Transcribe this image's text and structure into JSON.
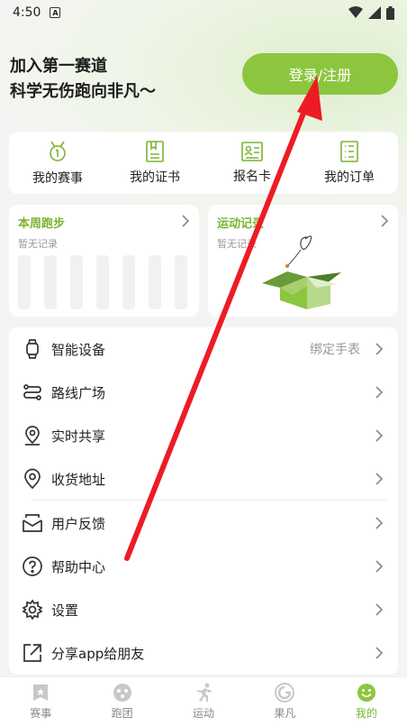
{
  "status_bar": {
    "time": "4:50",
    "notice_glyph": "A"
  },
  "header": {
    "slogan_line1": "加入第一赛道",
    "slogan_line2": "科学无伤跑向非凡～",
    "login_label": "登录/注册"
  },
  "quick_actions": [
    {
      "label": "我的赛事",
      "icon": "medal-icon"
    },
    {
      "label": "我的证书",
      "icon": "certificate-icon"
    },
    {
      "label": "报名卡",
      "icon": "id-card-icon"
    },
    {
      "label": "我的订单",
      "icon": "order-list-icon"
    }
  ],
  "weekly_run": {
    "title": "本周跑步",
    "empty_text": "暂无记录"
  },
  "activity_log": {
    "title": "运动记录",
    "empty_text": "暂无记录"
  },
  "menu": [
    {
      "label": "智能设备",
      "extra": "绑定手表",
      "icon": "watch-icon"
    },
    {
      "label": "路线广场",
      "icon": "route-icon"
    },
    {
      "label": "实时共享",
      "icon": "location-pin-icon"
    },
    {
      "label": "收货地址",
      "icon": "address-pin-icon"
    },
    {
      "label": "用户反馈",
      "icon": "feedback-mail-icon"
    },
    {
      "label": "帮助中心",
      "icon": "help-icon"
    },
    {
      "label": "设置",
      "icon": "gear-icon"
    },
    {
      "label": "分享app给朋友",
      "icon": "share-icon"
    }
  ],
  "tabs": [
    {
      "label": "赛事",
      "icon": "event-badge-icon"
    },
    {
      "label": "跑团",
      "icon": "team-icon"
    },
    {
      "label": "运动",
      "icon": "runner-icon"
    },
    {
      "label": "果凡",
      "icon": "guofan-icon"
    },
    {
      "label": "我的",
      "icon": "smile-icon",
      "active": true
    }
  ],
  "colors": {
    "accent": "#8cc63f",
    "accent_text": "#7ab332",
    "annotation_arrow": "#ec1c24"
  }
}
